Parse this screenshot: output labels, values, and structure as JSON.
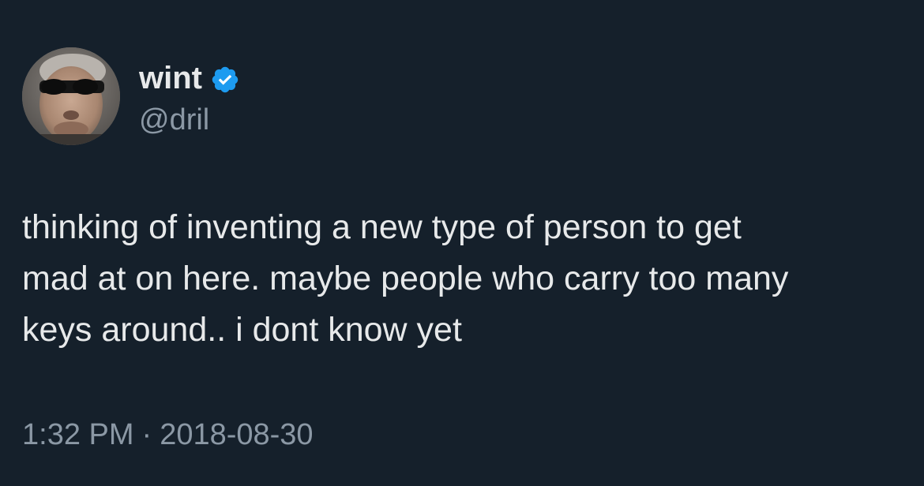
{
  "tweet": {
    "author": {
      "display_name": "wint",
      "handle": "@dril",
      "verified": true,
      "avatar_icon": "profile-photo"
    },
    "text": "thinking of inventing a new type of person to get\nmad at on here. maybe people who carry too many\nkeys around.. i dont know yet",
    "time": "1:32 PM",
    "separator": "·",
    "date": "2018-08-30"
  },
  "colors": {
    "background": "#15202b",
    "primary_text": "#e7e9ea",
    "secondary_text": "#8b98a5",
    "verified_badge": "#1d9bf0"
  }
}
